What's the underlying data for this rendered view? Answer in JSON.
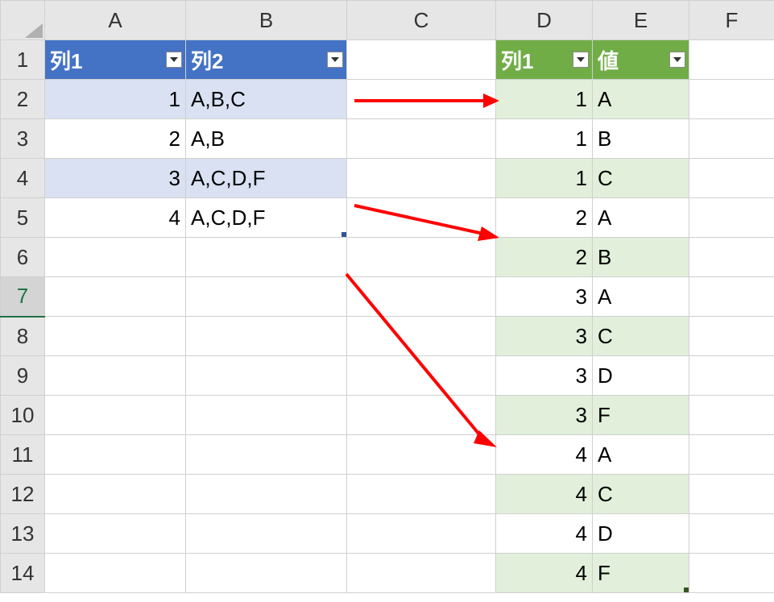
{
  "columns": [
    "A",
    "B",
    "C",
    "D",
    "E",
    "F"
  ],
  "rows": [
    "1",
    "2",
    "3",
    "4",
    "5",
    "6",
    "7",
    "8",
    "9",
    "10",
    "11",
    "12",
    "13",
    "14"
  ],
  "active_row": "7",
  "table1": {
    "headers": {
      "col1": "列1",
      "col2": "列2"
    },
    "rows": [
      {
        "c1": "1",
        "c2": "A,B,C"
      },
      {
        "c1": "2",
        "c2": "A,B"
      },
      {
        "c1": "3",
        "c2": "A,C,D,F"
      },
      {
        "c1": "4",
        "c2": "A,C,D,F"
      }
    ]
  },
  "table2": {
    "headers": {
      "col1": "列1",
      "col2": "値"
    },
    "rows": [
      {
        "c1": "1",
        "c2": "A"
      },
      {
        "c1": "1",
        "c2": "B"
      },
      {
        "c1": "1",
        "c2": "C"
      },
      {
        "c1": "2",
        "c2": "A"
      },
      {
        "c1": "2",
        "c2": "B"
      },
      {
        "c1": "3",
        "c2": "A"
      },
      {
        "c1": "3",
        "c2": "C"
      },
      {
        "c1": "3",
        "c2": "D"
      },
      {
        "c1": "3",
        "c2": "F"
      },
      {
        "c1": "4",
        "c2": "A"
      },
      {
        "c1": "4",
        "c2": "C"
      },
      {
        "c1": "4",
        "c2": "D"
      },
      {
        "c1": "4",
        "c2": "F"
      }
    ]
  }
}
